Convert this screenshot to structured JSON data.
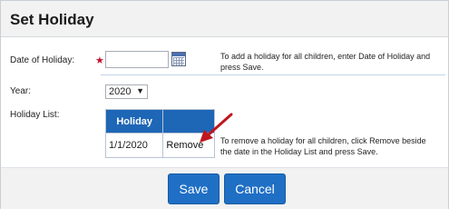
{
  "dialog": {
    "title": "Set Holiday"
  },
  "form": {
    "date_label": "Date of Holiday:",
    "date_required_mark": "★",
    "date_value": "",
    "date_help": "To add a holiday for all children, enter Date of Holiday and press Save.",
    "year_label": "Year:",
    "year_selected": "2020",
    "year_chevron": "▼",
    "list_label": "Holiday List:",
    "list_help": "To remove a holiday for all children, click Remove beside the date in the Holiday List and press Save."
  },
  "holiday_table": {
    "header_date": "Holiday",
    "header_action": "",
    "rows": [
      {
        "date": "1/1/2020",
        "action": "Remove"
      }
    ]
  },
  "footer": {
    "save_label": "Save",
    "cancel_label": "Cancel"
  },
  "colors": {
    "accent": "#1f6fc5",
    "table_header": "#1e66b6",
    "required": "#c8102e",
    "arrow": "#c0161e"
  },
  "icons": {
    "calendar": "calendar-icon",
    "arrow": "red-arrow-annotation"
  }
}
